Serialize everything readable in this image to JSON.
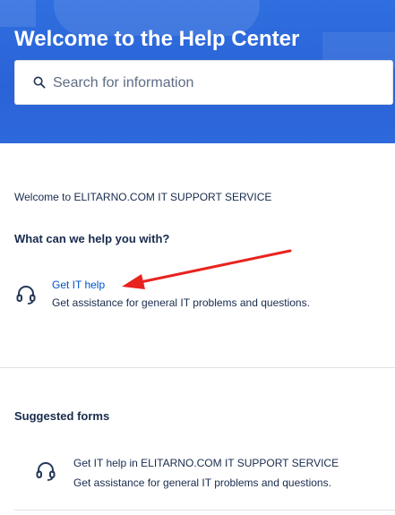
{
  "header": {
    "title": "Welcome to the Help Center",
    "search": {
      "placeholder": "Search for information",
      "value": "",
      "icon": "search-icon"
    },
    "background_color": "#2a63d6"
  },
  "main": {
    "welcome_message": "Welcome to ELITARNO.COM IT SUPPORT SERVICE",
    "help_section": {
      "heading": "What can we help you with?",
      "items": [
        {
          "title": "Get IT help",
          "description": "Get assistance for general IT problems and questions.",
          "icon": "headset-icon"
        }
      ]
    },
    "suggested_section": {
      "heading": "Suggested forms",
      "items": [
        {
          "title": "Get IT help in ELITARNO.COM IT SUPPORT SERVICE",
          "description": "Get assistance for general IT problems and questions.",
          "icon": "headset-icon"
        }
      ]
    },
    "link_color": "#0052cc",
    "annotation_arrow_color": "#e8231f"
  }
}
